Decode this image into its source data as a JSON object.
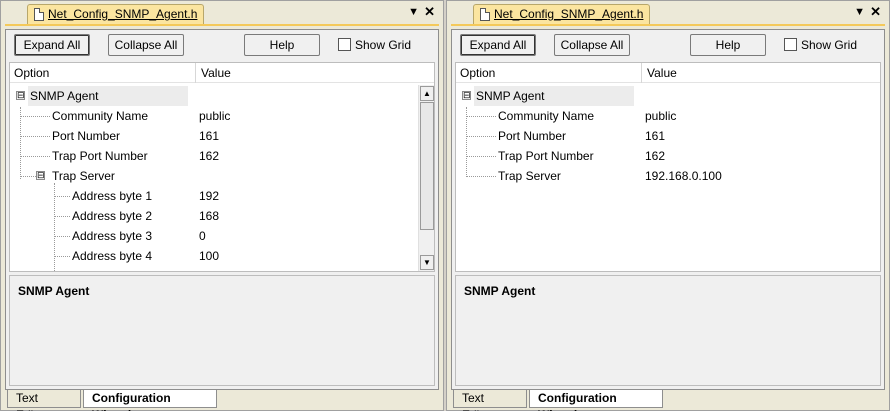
{
  "left": {
    "title": "Net_Config_SNMP_Agent.h",
    "pin": "▼",
    "close": "✕",
    "buttons": {
      "expand": "Expand All",
      "collapse": "Collapse All",
      "help": "Help",
      "show_grid": "Show Grid"
    },
    "columns": {
      "option": "Option",
      "value": "Value"
    },
    "rows": [
      {
        "label": "SNMP Agent",
        "value": ""
      },
      {
        "label": "Community Name",
        "value": "public"
      },
      {
        "label": "Port Number",
        "value": "161"
      },
      {
        "label": "Trap Port Number",
        "value": "162"
      },
      {
        "label": "Trap Server",
        "value": ""
      },
      {
        "label": "Address byte 1",
        "value": "192"
      },
      {
        "label": "Address byte 2",
        "value": "168"
      },
      {
        "label": "Address byte 3",
        "value": "0"
      },
      {
        "label": "Address byte 4",
        "value": "100"
      }
    ],
    "toggle_snmp": "⊟",
    "toggle_trap": "⊟",
    "description_title": "SNMP Agent",
    "tabs": {
      "text_editor": "Text Editor",
      "config_wizard": "Configuration Wizard"
    }
  },
  "right": {
    "title": "Net_Config_SNMP_Agent.h",
    "pin": "▼",
    "close": "✕",
    "buttons": {
      "expand": "Expand All",
      "collapse": "Collapse All",
      "help": "Help",
      "show_grid": "Show Grid"
    },
    "columns": {
      "option": "Option",
      "value": "Value"
    },
    "rows": [
      {
        "label": "SNMP Agent",
        "value": ""
      },
      {
        "label": "Community Name",
        "value": "public"
      },
      {
        "label": "Port Number",
        "value": "161"
      },
      {
        "label": "Trap Port Number",
        "value": "162"
      },
      {
        "label": "Trap Server",
        "value": "192.168.0.100"
      }
    ],
    "toggle_snmp": "⊟",
    "description_title": "SNMP Agent",
    "tabs": {
      "text_editor": "Text Editor",
      "config_wizard": "Configuration Wizard"
    }
  },
  "colors": {
    "tab_accent": "#fbe5a0",
    "title_line": "#f4c95a",
    "group_row_bg": "#ececec"
  }
}
